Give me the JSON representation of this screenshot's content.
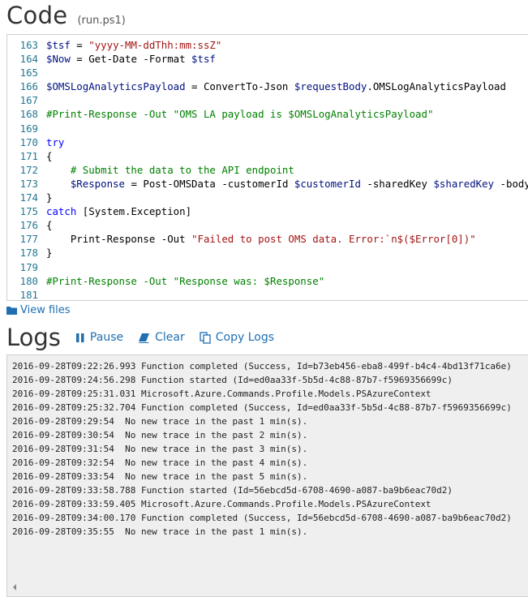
{
  "code_section": {
    "title": "Code",
    "subtitle": "(run.ps1)",
    "lines": [
      {
        "num": "163",
        "segments": [
          {
            "t": "$tsf",
            "c": "var"
          },
          {
            "t": " = ",
            "c": "op"
          },
          {
            "t": "\"yyyy-MM-ddThh:mm:ssZ\"",
            "c": "str"
          }
        ]
      },
      {
        "num": "164",
        "segments": [
          {
            "t": "$Now",
            "c": "var"
          },
          {
            "t": " = Get-Date -Format ",
            "c": "op"
          },
          {
            "t": "$tsf",
            "c": "var"
          }
        ]
      },
      {
        "num": "165",
        "segments": []
      },
      {
        "num": "166",
        "segments": [
          {
            "t": "$OMSLogAnalyticsPayload",
            "c": "var"
          },
          {
            "t": " = ConvertTo-Json ",
            "c": "op"
          },
          {
            "t": "$requestBody",
            "c": "var"
          },
          {
            "t": ".OMSLogAnalyticsPayload",
            "c": "op"
          }
        ]
      },
      {
        "num": "167",
        "segments": []
      },
      {
        "num": "168",
        "segments": [
          {
            "t": "#Print-Response -Out \"OMS LA payload is $OMSLogAnalyticsPayload\"",
            "c": "com"
          }
        ]
      },
      {
        "num": "169",
        "segments": []
      },
      {
        "num": "170",
        "segments": [
          {
            "t": "try",
            "c": "kw"
          }
        ]
      },
      {
        "num": "171",
        "segments": [
          {
            "t": "{",
            "c": "op"
          }
        ]
      },
      {
        "num": "172",
        "segments": [
          {
            "t": "    # Submit the data to the API endpoint",
            "c": "com"
          }
        ]
      },
      {
        "num": "173",
        "segments": [
          {
            "t": "    ",
            "c": "op"
          },
          {
            "t": "$Response",
            "c": "var"
          },
          {
            "t": " = Post-OMSData -customerId ",
            "c": "op"
          },
          {
            "t": "$customerId",
            "c": "var"
          },
          {
            "t": " -sharedKey ",
            "c": "op"
          },
          {
            "t": "$sharedKey",
            "c": "var"
          },
          {
            "t": " -body ",
            "c": "op"
          }
        ]
      },
      {
        "num": "174",
        "segments": [
          {
            "t": "}",
            "c": "op"
          }
        ]
      },
      {
        "num": "175",
        "segments": [
          {
            "t": "catch",
            "c": "kw"
          },
          {
            "t": " [System.Exception]",
            "c": "op"
          }
        ]
      },
      {
        "num": "176",
        "segments": [
          {
            "t": "{",
            "c": "op"
          }
        ]
      },
      {
        "num": "177",
        "segments": [
          {
            "t": "    Print-Response -Out ",
            "c": "op"
          },
          {
            "t": "\"Failed to post OMS data. Error:`n$($Error[0])\"",
            "c": "str"
          }
        ]
      },
      {
        "num": "178",
        "segments": [
          {
            "t": "}",
            "c": "op"
          }
        ]
      },
      {
        "num": "179",
        "segments": []
      },
      {
        "num": "180",
        "segments": [
          {
            "t": "#Print-Response -Out \"Response was: $Response\"",
            "c": "com"
          }
        ]
      },
      {
        "num": "181",
        "segments": []
      }
    ]
  },
  "view_files_label": "View files",
  "logs_section": {
    "title": "Logs",
    "pause_label": "Pause",
    "clear_label": "Clear",
    "copy_label": "Copy Logs",
    "lines": [
      "2016-09-28T09:22:26.993 Function completed (Success, Id=b73eb456-eba8-499f-b4c4-4bd13f71ca6e)",
      "2016-09-28T09:24:56.298 Function started (Id=ed0aa33f-5b5d-4c88-87b7-f5969356699c)",
      "2016-09-28T09:25:31.031 Microsoft.Azure.Commands.Profile.Models.PSAzureContext",
      "2016-09-28T09:25:32.704 Function completed (Success, Id=ed0aa33f-5b5d-4c88-87b7-f5969356699c)",
      "2016-09-28T09:29:54  No new trace in the past 1 min(s).",
      "2016-09-28T09:30:54  No new trace in the past 2 min(s).",
      "2016-09-28T09:31:54  No new trace in the past 3 min(s).",
      "2016-09-28T09:32:54  No new trace in the past 4 min(s).",
      "2016-09-28T09:33:54  No new trace in the past 5 min(s).",
      "2016-09-28T09:33:58.788 Function started (Id=56ebcd5d-6708-4690-a087-ba9b6eac70d2)",
      "2016-09-28T09:33:59.405 Microsoft.Azure.Commands.Profile.Models.PSAzureContext",
      "2016-09-28T09:34:00.170 Function completed (Success, Id=56ebcd5d-6708-4690-a087-ba9b6eac70d2)",
      "2016-09-28T09:35:55  No new trace in the past 1 min(s)."
    ]
  },
  "colors": {
    "link": "#1f6fb2",
    "line_number": "#237893",
    "string": "#a31515",
    "comment": "#008000",
    "keyword": "#0000ff",
    "variable": "#001080",
    "log_background": "#efefef"
  },
  "icons": {
    "folder": "folder-icon",
    "pause": "pause-icon",
    "clear": "eraser-icon",
    "copy": "copy-icon",
    "scroll_left": "scroll-left-icon"
  }
}
